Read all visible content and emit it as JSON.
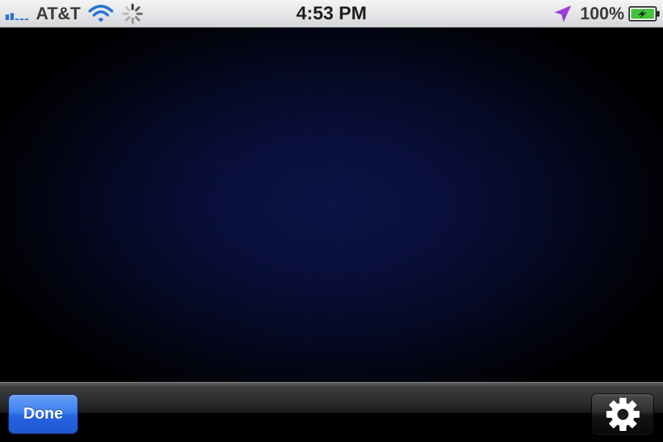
{
  "status_bar": {
    "carrier": "AT&T",
    "time": "4:53 PM",
    "battery_percent": "100%",
    "icons": [
      "signal-strength-icon",
      "wifi-icon",
      "activity-spinner-icon",
      "location-arrow-icon",
      "battery-charging-icon"
    ],
    "location_color": "#9b3fd8",
    "battery_fill_color": "#3fc43a"
  },
  "toolbar": {
    "done_label": "Done",
    "settings_icon": "gear-icon",
    "done_color": "#2f6fe8"
  },
  "viewport": {
    "background_center_color": "#0c154a"
  }
}
